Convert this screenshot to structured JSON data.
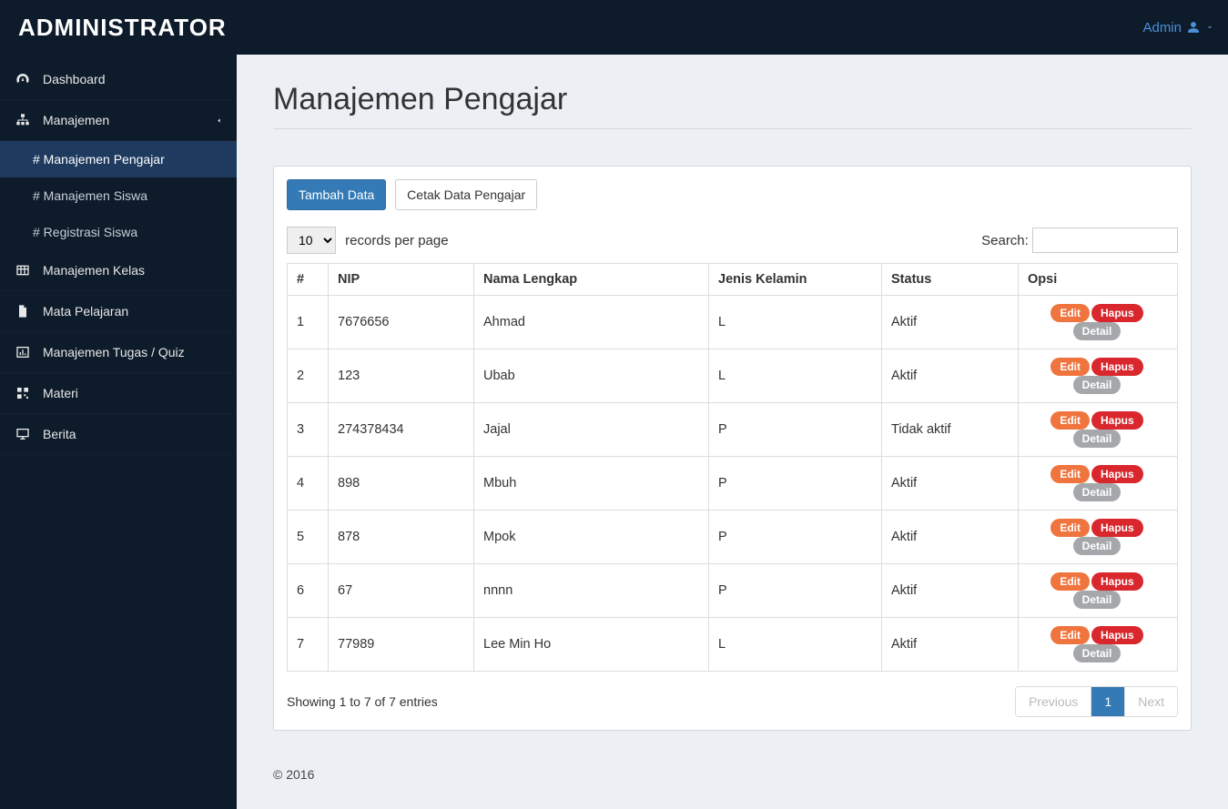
{
  "header": {
    "brand": "ADMINISTRATOR",
    "user_label": "Admin"
  },
  "sidebar": {
    "items": [
      {
        "label": "Dashboard"
      },
      {
        "label": "Manajemen",
        "expanded": true
      },
      {
        "label": "Manajemen Kelas"
      },
      {
        "label": "Mata Pelajaran"
      },
      {
        "label": "Manajemen Tugas / Quiz"
      },
      {
        "label": "Materi"
      },
      {
        "label": "Berita"
      }
    ],
    "submenu": [
      {
        "label": "# Manajemen Pengajar",
        "active": true
      },
      {
        "label": "# Manajemen Siswa"
      },
      {
        "label": "# Registrasi Siswa"
      }
    ]
  },
  "page": {
    "title": "Manajemen Pengajar",
    "add_btn": "Tambah Data",
    "print_btn": "Cetak Data Pengajar",
    "records_label": "records per page",
    "records_value": "10",
    "search_label": "Search:",
    "showing": "Showing 1 to 7 of 7 entries",
    "prev": "Previous",
    "page1": "1",
    "next": "Next",
    "footer": "© 2016"
  },
  "table": {
    "headers": [
      "#",
      "NIP",
      "Nama Lengkap",
      "Jenis Kelamin",
      "Status",
      "Opsi"
    ],
    "action_labels": {
      "edit": "Edit",
      "delete": "Hapus",
      "detail": "Detail"
    },
    "rows": [
      {
        "n": "1",
        "nip": "7676656",
        "nama": "Ahmad",
        "jk": "L",
        "status": "Aktif"
      },
      {
        "n": "2",
        "nip": "123",
        "nama": "Ubab",
        "jk": "L",
        "status": "Aktif"
      },
      {
        "n": "3",
        "nip": "274378434",
        "nama": "Jajal",
        "jk": "P",
        "status": "Tidak aktif"
      },
      {
        "n": "4",
        "nip": "898",
        "nama": "Mbuh",
        "jk": "P",
        "status": "Aktif"
      },
      {
        "n": "5",
        "nip": "878",
        "nama": "Mpok",
        "jk": "P",
        "status": "Aktif"
      },
      {
        "n": "6",
        "nip": "67",
        "nama": "nnnn",
        "jk": "P",
        "status": "Aktif"
      },
      {
        "n": "7",
        "nip": "77989",
        "nama": "Lee Min Ho",
        "jk": "L",
        "status": "Aktif"
      }
    ]
  }
}
